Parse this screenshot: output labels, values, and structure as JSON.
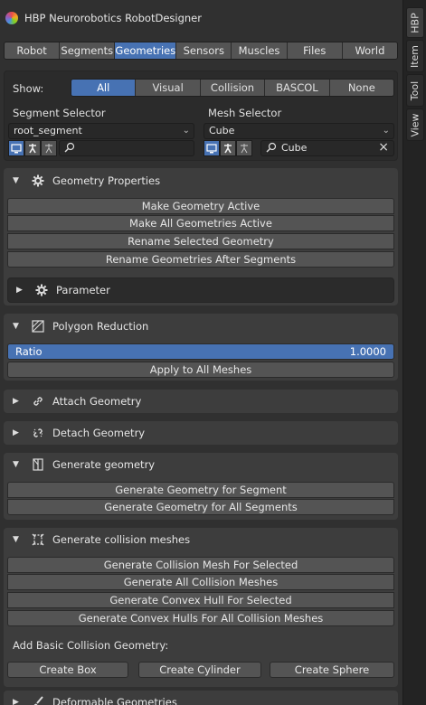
{
  "window": {
    "title": "HBP Neurorobotics RobotDesigner"
  },
  "sidebar_tabs": [
    "HBP",
    "Item",
    "Tool",
    "View"
  ],
  "main_tabs": [
    "Robot",
    "Segments",
    "Geometries",
    "Sensors",
    "Muscles",
    "Files",
    "World"
  ],
  "active_tab": "Geometries",
  "show": {
    "label": "Show:",
    "options": [
      "All",
      "Visual",
      "Collision",
      "BASCOL",
      "None"
    ],
    "selected": "All"
  },
  "segment_selector": {
    "label": "Segment Selector",
    "value": "root_segment",
    "search": ""
  },
  "mesh_selector": {
    "label": "Mesh Selector",
    "value": "Cube",
    "search": "Cube"
  },
  "geometry_properties": {
    "title": "Geometry Properties",
    "buttons": [
      "Make Geometry Active",
      "Make All Geometries Active",
      "Rename Selected Geometry",
      "Rename Geometries After Segments"
    ],
    "subpanel": "Parameter"
  },
  "polygon_reduction": {
    "title": "Polygon Reduction",
    "ratio_label": "Ratio",
    "ratio_value": "1.0000",
    "apply_label": "Apply to All Meshes"
  },
  "attach_geometry": {
    "title": "Attach Geometry"
  },
  "detach_geometry": {
    "title": "Detach Geometry"
  },
  "generate_geometry": {
    "title": "Generate geometry",
    "buttons": [
      "Generate Geometry for Segment",
      "Generate Geometry for All Segments"
    ]
  },
  "generate_collision": {
    "title": "Generate collision meshes",
    "buttons": [
      "Generate Collision Mesh For Selected",
      "Generate All Collision Meshes",
      "Generate Convex Hull For Selected",
      "Generate Convex Hulls For All Collision Meshes"
    ],
    "basic_label": "Add Basic Collision Geometry:",
    "basic_buttons": [
      "Create Box",
      "Create Cylinder",
      "Create Sphere"
    ]
  },
  "deformable": {
    "title": "Deformable Geometries"
  },
  "colors": {
    "accent": "#4772b3",
    "panel": "#3d3d3d",
    "button": "#545454",
    "background": "#303030"
  }
}
